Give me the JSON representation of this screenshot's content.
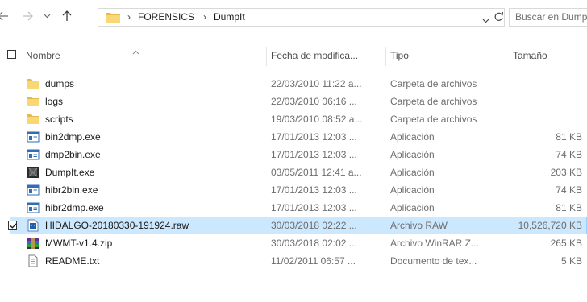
{
  "nav": {
    "back_icon": "arrow-left-icon",
    "forward_icon": "arrow-right-icon",
    "recent_icon": "chevron-down-icon",
    "up_icon": "arrow-up-icon"
  },
  "address_bar": {
    "folder_icon": "folder-icon",
    "breadcrumb": [
      "FORENSICS",
      "DumpIt"
    ],
    "separator": "›",
    "dropdown_icon": "chevron-down-icon",
    "refresh_icon": "refresh-icon"
  },
  "search": {
    "placeholder": "Buscar en DumpIt"
  },
  "columns": {
    "name": "Nombre",
    "date": "Fecha de modifica...",
    "type": "Tipo",
    "size": "Tamaño"
  },
  "colors": {
    "selection_fill": "#cce8ff",
    "selection_border": "#99d1ff",
    "folder": "#f8d775",
    "text_secondary": "#6d6d6d"
  },
  "files": [
    {
      "name": "dumps",
      "date": "22/03/2010 11:22 a...",
      "type": "Carpeta de archivos",
      "size": "",
      "icon": "folder-icon",
      "selected": false
    },
    {
      "name": "logs",
      "date": "22/03/2010 06:16 ...",
      "type": "Carpeta de archivos",
      "size": "",
      "icon": "folder-icon",
      "selected": false
    },
    {
      "name": "scripts",
      "date": "19/03/2010 08:52 a...",
      "type": "Carpeta de archivos",
      "size": "",
      "icon": "folder-icon",
      "selected": false
    },
    {
      "name": "bin2dmp.exe",
      "date": "17/01/2013 12:03 ...",
      "type": "Aplicación",
      "size": "81 KB",
      "icon": "exe-icon",
      "selected": false
    },
    {
      "name": "dmp2bin.exe",
      "date": "17/01/2013 12:03 ...",
      "type": "Aplicación",
      "size": "74 KB",
      "icon": "exe-icon",
      "selected": false
    },
    {
      "name": "DumpIt.exe",
      "date": "03/05/2011 12:41 a...",
      "type": "Aplicación",
      "size": "203 KB",
      "icon": "dumpit-icon",
      "selected": false
    },
    {
      "name": "hibr2bin.exe",
      "date": "17/01/2013 12:03 ...",
      "type": "Aplicación",
      "size": "74 KB",
      "icon": "exe-icon",
      "selected": false
    },
    {
      "name": "hibr2dmp.exe",
      "date": "17/01/2013 12:03 ...",
      "type": "Aplicación",
      "size": "81 KB",
      "icon": "exe-icon",
      "selected": false
    },
    {
      "name": "HIDALGO-20180330-191924.raw",
      "date": "30/03/2018 02:22 ...",
      "type": "Archivo RAW",
      "size": "10,526,720 KB",
      "icon": "raw-file-icon",
      "selected": true
    },
    {
      "name": "MWMT-v1.4.zip",
      "date": "30/03/2018 02:02 ...",
      "type": "Archivo WinRAR Z...",
      "size": "265 KB",
      "icon": "winrar-icon",
      "selected": false
    },
    {
      "name": "README.txt",
      "date": "11/02/2011 06:57 ...",
      "type": "Documento de tex...",
      "size": "5 KB",
      "icon": "text-file-icon",
      "selected": false
    }
  ]
}
